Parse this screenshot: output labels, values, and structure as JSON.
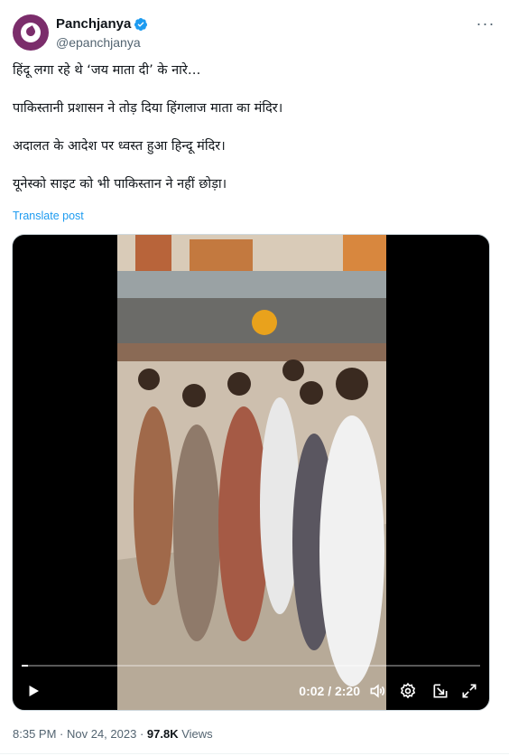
{
  "author": {
    "display_name": "Panchjanya",
    "handle": "@epanchjanya",
    "avatar_color": "#7b2d6b",
    "verified_color": "#1d9bf0"
  },
  "tweet": {
    "lines": [
      "हिंदू लगा रहे थे ‘जय माता दी’ के नारे…",
      "पाकिस्तानी प्रशासन ने तोड़ दिया हिंगलाज माता का मंदिर।",
      "अदालत के आदेश पर ध्वस्त हुआ हिन्दू मंदिर।",
      "यूनेस्को साइट को भी पाकिस्तान ने नहीं छोड़ा।"
    ],
    "translate_label": "Translate post"
  },
  "video": {
    "time_display": "0:02 / 2:20",
    "progress_fraction": 0.014,
    "icons": [
      "play-icon",
      "volume-icon",
      "settings-icon",
      "popout-icon",
      "fullscreen-icon"
    ]
  },
  "meta": {
    "time": "8:35 PM",
    "date": "Nov 24, 2023",
    "views_count": "97.8K",
    "views_label": "Views"
  }
}
